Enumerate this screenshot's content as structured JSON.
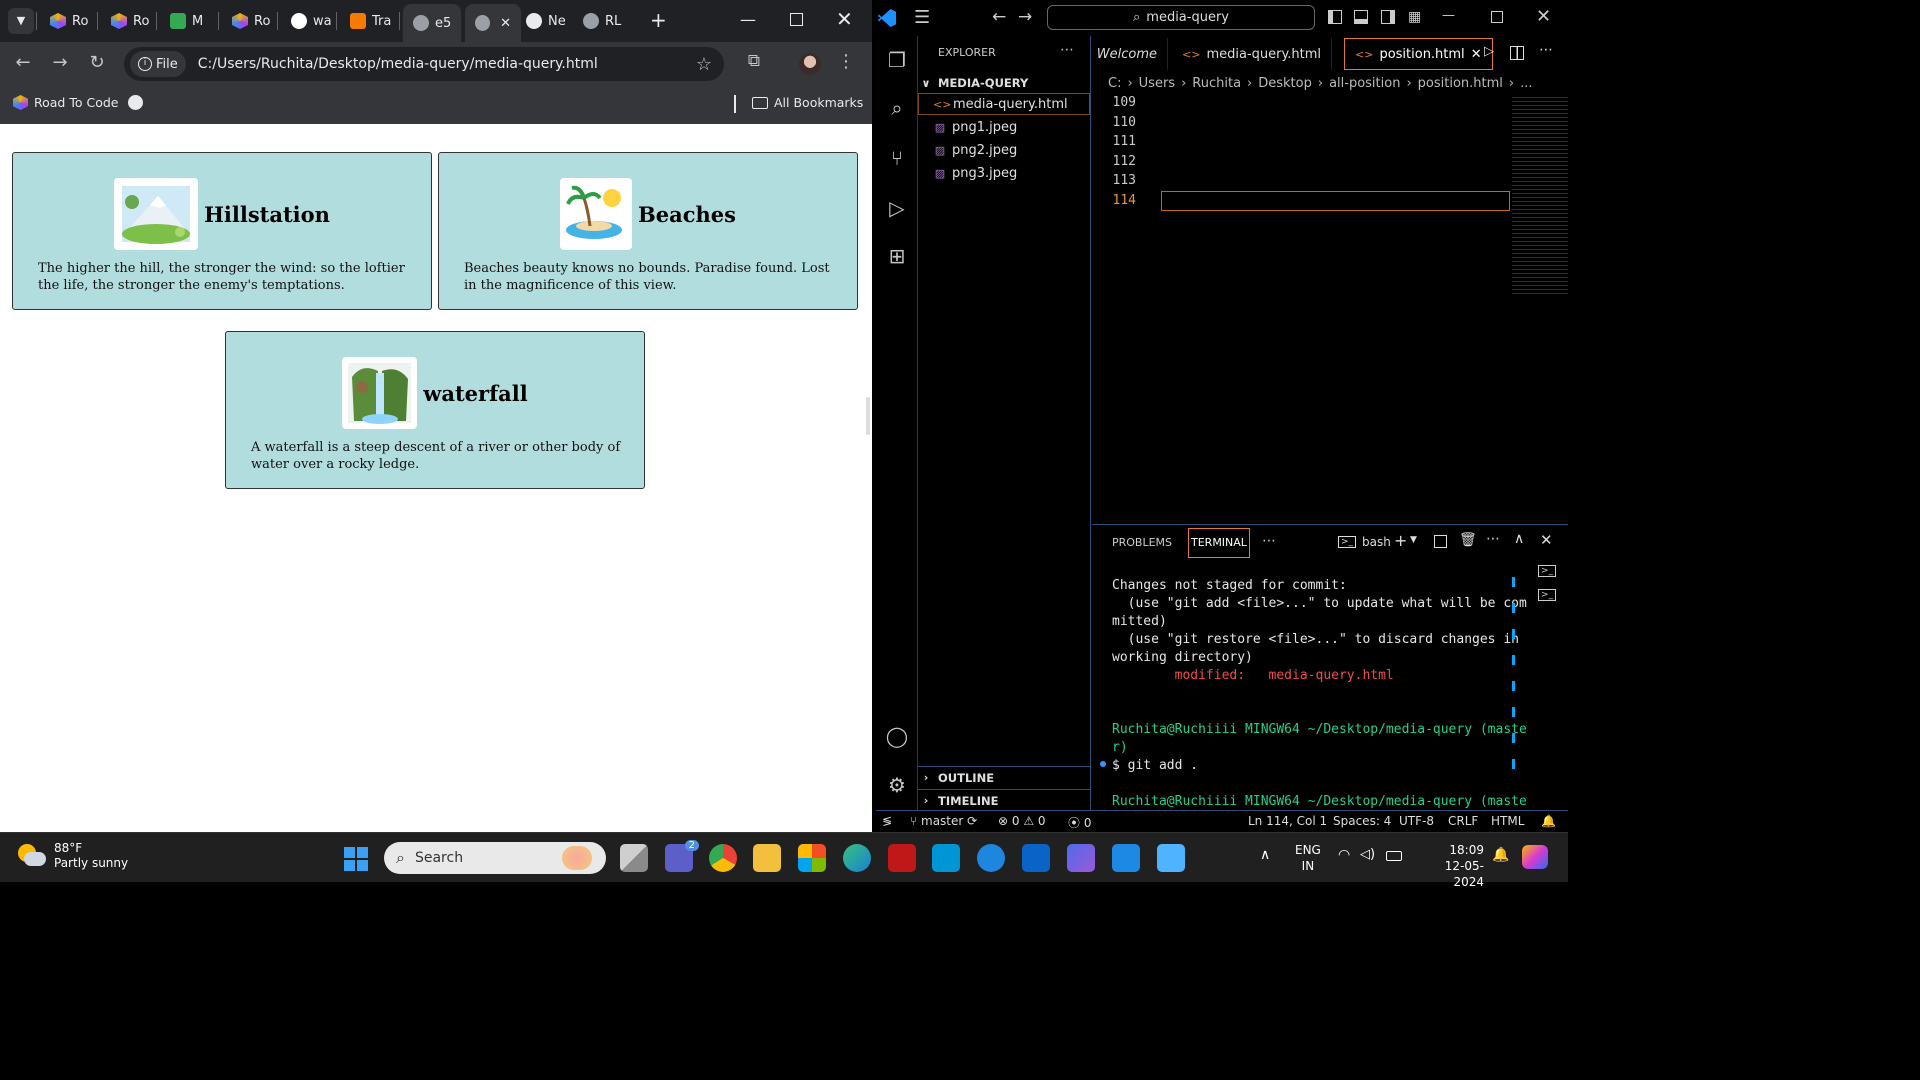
{
  "browser": {
    "tabs": [
      {
        "label": "Ro",
        "icon": "hexagon-logo-icon",
        "color": "#f4b400"
      },
      {
        "label": "Ro",
        "icon": "hexagon-logo-icon",
        "color": "#f4b400"
      },
      {
        "label": "M",
        "icon": "sheets-icon",
        "color": "#34a853"
      },
      {
        "label": "Ro",
        "icon": "hexagon-logo-icon",
        "color": "#f4b400"
      },
      {
        "label": "wa",
        "icon": "google-icon",
        "color": "#ffffff"
      },
      {
        "label": "Tra",
        "icon": "blogger-icon",
        "color": "#f57c00"
      },
      {
        "label": "e5",
        "icon": "globe-icon",
        "color": "#9aa0a6"
      },
      {
        "label": "Ne",
        "icon": "chrome-icon",
        "color": "#e8eaed"
      },
      {
        "label": "RL",
        "icon": "github-icon",
        "color": "#9aa0a6"
      }
    ],
    "address": {
      "scheme_label": "File",
      "url": "C:/Users/Ruchita/Desktop/media-query/media-query.html"
    },
    "bookmarks": {
      "item1": "Road To Code",
      "all": "All Bookmarks"
    }
  },
  "page": {
    "cards": [
      {
        "title": "Hillstation",
        "text": "The higher the hill, the stronger the wind: so the loftier the life, the stronger the enemy's temptations."
      },
      {
        "title": "Beaches",
        "text": "Beaches beauty knows no bounds. Paradise found. Lost in the magnificence of this view."
      },
      {
        "title": "waterfall",
        "text": "A waterfall is a steep descent of a river or other body of water over a rocky ledge."
      }
    ]
  },
  "vscode": {
    "search": "media-query",
    "explorer": {
      "title": "EXPLORER",
      "folder": "MEDIA-QUERY",
      "files": [
        "media-query.html",
        "png1.jpeg",
        "png2.jpeg",
        "png3.jpeg"
      ],
      "outline": "OUTLINE",
      "timeline": "TIMELINE"
    },
    "tabs": [
      "Welcome",
      "media-query.html",
      "position.html"
    ],
    "breadcrumbs": [
      "C:",
      "Users",
      "Ruchita",
      "Desktop",
      "all-position",
      "position.html",
      "..."
    ],
    "line_numbers": [
      "109",
      "110",
      "111",
      "112",
      "113",
      "114"
    ],
    "panel": {
      "problems": "PROBLEMS",
      "terminal": "TERMINAL",
      "shell": "bash"
    },
    "terminal_lines": [
      {
        "text": "Changes not staged for commit:",
        "color": "#e6e6e6"
      },
      {
        "text": "  (use \"git add <file>...\" to update what will be com",
        "color": "#e6e6e6"
      },
      {
        "text": "mitted)",
        "color": "#e6e6e6"
      },
      {
        "text": "  (use \"git restore <file>...\" to discard changes in",
        "color": "#e6e6e6"
      },
      {
        "text": "working directory)",
        "color": "#e6e6e6"
      },
      {
        "text": "        modified:   media-query.html",
        "color": "#f14c4c"
      },
      {
        "text": "",
        "color": "#e6e6e6"
      },
      {
        "text": "",
        "color": "#e6e6e6"
      },
      {
        "text": "Ruchita@Ruchiiii MINGW64 ~/Desktop/media-query (maste",
        "color": "#23d18b"
      },
      {
        "text": "r)",
        "color": "#23d18b"
      },
      {
        "text": "$ git add .",
        "color": "#e6e6e6"
      },
      {
        "text": "",
        "color": "#e6e6e6"
      },
      {
        "text": "Ruchita@Ruchiiii MINGW64 ~/Desktop/media-query (maste",
        "color": "#23d18b"
      }
    ],
    "status": {
      "branch": "master",
      "errors": "0",
      "warnings": "0",
      "ports": "0",
      "position": "Ln 114, Col 1",
      "spaces": "Spaces: 4",
      "encoding": "UTF-8",
      "eol": "CRLF",
      "language": "HTML"
    }
  },
  "taskbar": {
    "weather_temp": "88°F",
    "weather_desc": "Partly sunny",
    "search_placeholder": "Search",
    "teams_badge": "2",
    "lang": "ENG",
    "region": "IN",
    "time": "18:09",
    "date": "12-05-2024"
  }
}
